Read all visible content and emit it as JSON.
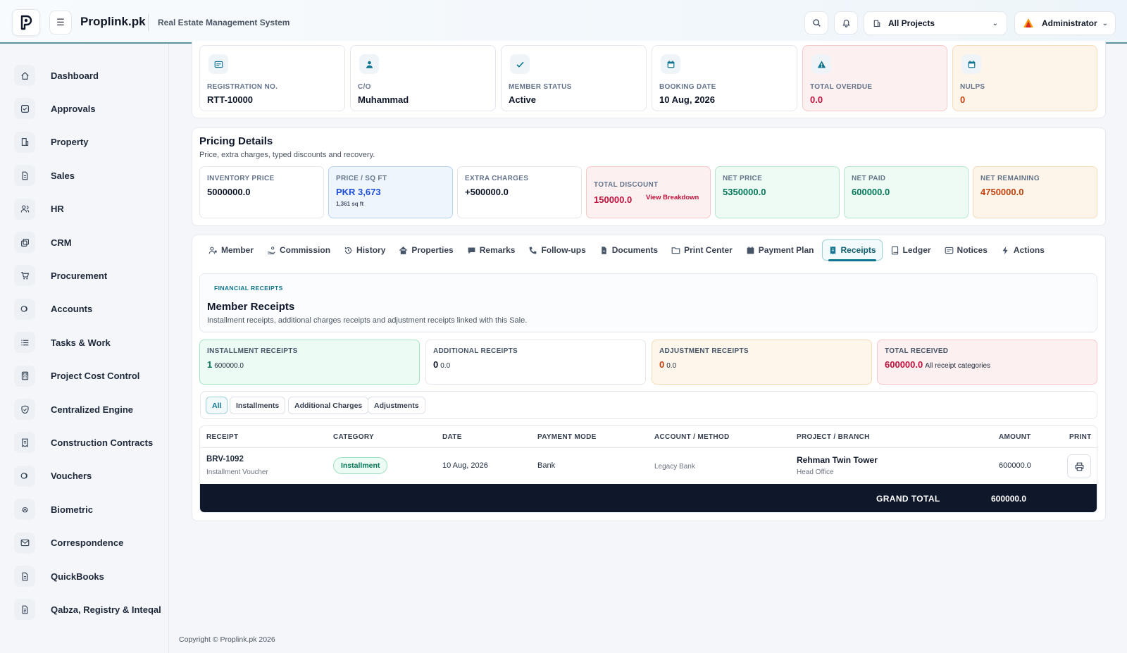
{
  "header": {
    "brand": "Proplink.pk",
    "subtitle": "Real Estate Management System",
    "project_select": "All Projects",
    "user": "Administrator"
  },
  "sidebar": {
    "items": [
      {
        "label": "Dashboard",
        "icon": "home-icon"
      },
      {
        "label": "Approvals",
        "icon": "check-square-icon"
      },
      {
        "label": "Property",
        "icon": "building-icon"
      },
      {
        "label": "Sales",
        "icon": "file-icon"
      },
      {
        "label": "HR",
        "icon": "users-icon"
      },
      {
        "label": "CRM",
        "icon": "copy-icon"
      },
      {
        "label": "Procurement",
        "icon": "cart-icon"
      },
      {
        "label": "Accounts",
        "icon": "coins-icon"
      },
      {
        "label": "Tasks & Work",
        "icon": "list-icon"
      },
      {
        "label": "Project Cost Control",
        "icon": "calculator-icon"
      },
      {
        "label": "Centralized Engine",
        "icon": "shield-icon"
      },
      {
        "label": "Construction Contracts",
        "icon": "receipt-icon"
      },
      {
        "label": "Vouchers",
        "icon": "coins-icon"
      },
      {
        "label": "Biometric",
        "icon": "fingerprint-icon"
      },
      {
        "label": "Correspondence",
        "icon": "mail-icon"
      },
      {
        "label": "QuickBooks",
        "icon": "file-icon"
      },
      {
        "label": "Qabza, Registry & Inteqal",
        "icon": "file-text-icon"
      }
    ]
  },
  "summary": [
    {
      "label": "REGISTRATION NO.",
      "value": "RTT-10000",
      "icon": "id-card-icon"
    },
    {
      "label": "C/O",
      "value": "Muhammad",
      "icon": "user-icon"
    },
    {
      "label": "MEMBER STATUS",
      "value": "Active",
      "icon": "check-icon"
    },
    {
      "label": "BOOKING DATE",
      "value": "10 Aug, 2026",
      "icon": "calendar-icon"
    },
    {
      "label": "TOTAL OVERDUE",
      "value": "0.0",
      "icon": "warning-icon"
    },
    {
      "label": "NULPS",
      "value": "0",
      "icon": "calendar-icon"
    }
  ],
  "pricing": {
    "title": "Pricing Details",
    "subtitle": "Price, extra charges, typed discounts and recovery.",
    "inventory_price": {
      "label": "INVENTORY PRICE",
      "value": "5000000.0"
    },
    "price_sqft": {
      "label": "PRICE / SQ FT",
      "value": "PKR 3,673",
      "sub": "1,361 sq ft"
    },
    "extra_charges": {
      "label": "EXTRA CHARGES",
      "value": "+500000.0"
    },
    "total_discount": {
      "label": "TOTAL DISCOUNT",
      "value": "150000.0",
      "link": "View Breakdown"
    },
    "net_price": {
      "label": "NET PRICE",
      "value": "5350000.0"
    },
    "net_paid": {
      "label": "NET PAID",
      "value": "600000.0"
    },
    "net_remaining": {
      "label": "NET REMAINING",
      "value": "4750000.0"
    }
  },
  "tabs": [
    {
      "label": "Member",
      "icon": "user-icon"
    },
    {
      "label": "Commission",
      "icon": "hand-coin-icon"
    },
    {
      "label": "History",
      "icon": "history-icon"
    },
    {
      "label": "Properties",
      "icon": "home-icon"
    },
    {
      "label": "Remarks",
      "icon": "comment-icon"
    },
    {
      "label": "Follow-ups",
      "icon": "phone-icon"
    },
    {
      "label": "Documents",
      "icon": "file-icon"
    },
    {
      "label": "Print Center",
      "icon": "folder-icon"
    },
    {
      "label": "Payment Plan",
      "icon": "calendar-icon"
    },
    {
      "label": "Receipts",
      "icon": "receipt-icon"
    },
    {
      "label": "Ledger",
      "icon": "book-icon"
    },
    {
      "label": "Notices",
      "icon": "notice-icon"
    },
    {
      "label": "Actions",
      "icon": "bolt-icon"
    }
  ],
  "receipts": {
    "eyebrow": "FINANCIAL RECEIPTS",
    "title": "Member Receipts",
    "subtitle": "Installment receipts, additional charges receipts and adjustment receipts linked with this Sale.",
    "installment": {
      "label": "INSTALLMENT RECEIPTS",
      "count": "1",
      "amount": "600000.0"
    },
    "additional": {
      "label": "ADDITIONAL RECEIPTS",
      "count": "0",
      "amount": "0.0"
    },
    "adjustment": {
      "label": "ADJUSTMENT RECEIPTS",
      "count": "0",
      "amount": "0.0"
    },
    "total": {
      "label": "TOTAL RECEIVED",
      "amount": "600000.0",
      "note": "All receipt categories"
    }
  },
  "filters": [
    "All",
    "Installments",
    "Additional Charges",
    "Adjustments"
  ],
  "table": {
    "columns": [
      "RECEIPT",
      "CATEGORY",
      "DATE",
      "PAYMENT MODE",
      "ACCOUNT / METHOD",
      "PROJECT / BRANCH",
      "AMOUNT",
      "PRINT"
    ],
    "rows": [
      {
        "receipt": "BRV-1092",
        "receipt_sub": "Installment Voucher",
        "category": "Installment",
        "date": "10 Aug, 2026",
        "mode": "Bank",
        "account": "Legacy Bank",
        "project": "Rehman Twin Tower",
        "branch": "Head Office",
        "amount": "600000.0"
      }
    ],
    "grand_total_label": "GRAND TOTAL",
    "grand_total": "600000.0"
  },
  "footer": "Copyright © Proplink.pk 2026",
  "colors": {
    "accent": "#0e7490",
    "danger": "#be123c",
    "success": "#047857",
    "warning": "#c2410c",
    "dark": "#0f172a"
  }
}
